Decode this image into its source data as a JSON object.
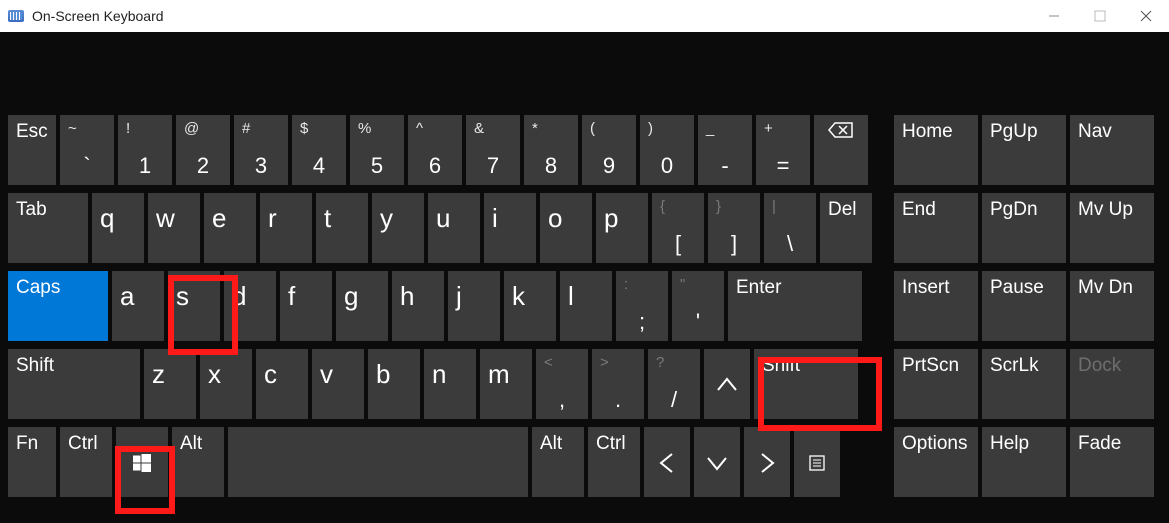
{
  "window": {
    "title": "On-Screen Keyboard"
  },
  "rows": {
    "r1": {
      "esc": "Esc",
      "tilde_u": "~",
      "tilde_l": "`",
      "n1_u": "!",
      "n1_l": "1",
      "n2_u": "@",
      "n2_l": "2",
      "n3_u": "#",
      "n3_l": "3",
      "n4_u": "$",
      "n4_l": "4",
      "n5_u": "%",
      "n5_l": "5",
      "n6_u": "^",
      "n6_l": "6",
      "n7_u": "&",
      "n7_l": "7",
      "n8_u": "*",
      "n8_l": "8",
      "n9_u": "(",
      "n9_l": "9",
      "n0_u": ")",
      "n0_l": "0",
      "min_u": "_",
      "min_l": "-",
      "eq_u": "+",
      "eq_l": "="
    },
    "r2": {
      "tab": "Tab",
      "q": "q",
      "w": "w",
      "e": "e",
      "r": "r",
      "t": "t",
      "y": "y",
      "u": "u",
      "i": "i",
      "o": "o",
      "p": "p",
      "lb_u": "{",
      "lb_l": "[",
      "rb_u": "}",
      "rb_l": "]",
      "bs_u": "|",
      "bs_l": "\\",
      "del": "Del"
    },
    "r3": {
      "caps": "Caps",
      "a": "a",
      "s": "s",
      "d": "d",
      "f": "f",
      "g": "g",
      "h": "h",
      "j": "j",
      "k": "k",
      "l": "l",
      "sc_u": ":",
      "sc_l": ";",
      "qt_u": "\"",
      "qt_l": "'",
      "enter": "Enter"
    },
    "r4": {
      "lshift": "Shift",
      "z": "z",
      "x": "x",
      "c": "c",
      "v": "v",
      "b": "b",
      "n": "n",
      "m": "m",
      "cm_u": "<",
      "cm_l": ",",
      "pd_u": ">",
      "pd_l": ".",
      "sl_u": "?",
      "sl_l": "/",
      "rshift": "Shift"
    },
    "r5": {
      "fn": "Fn",
      "lctrl": "Ctrl",
      "lalt": "Alt",
      "ralt": "Alt",
      "rctrl": "Ctrl"
    }
  },
  "side": {
    "home": "Home",
    "pgup": "PgUp",
    "nav": "Nav",
    "end": "End",
    "pgdn": "PgDn",
    "mvup": "Mv Up",
    "insert": "Insert",
    "pause": "Pause",
    "mvdn": "Mv Dn",
    "prtscn": "PrtScn",
    "scrlk": "ScrLk",
    "dock": "Dock",
    "options": "Options",
    "help": "Help",
    "fade": "Fade"
  }
}
